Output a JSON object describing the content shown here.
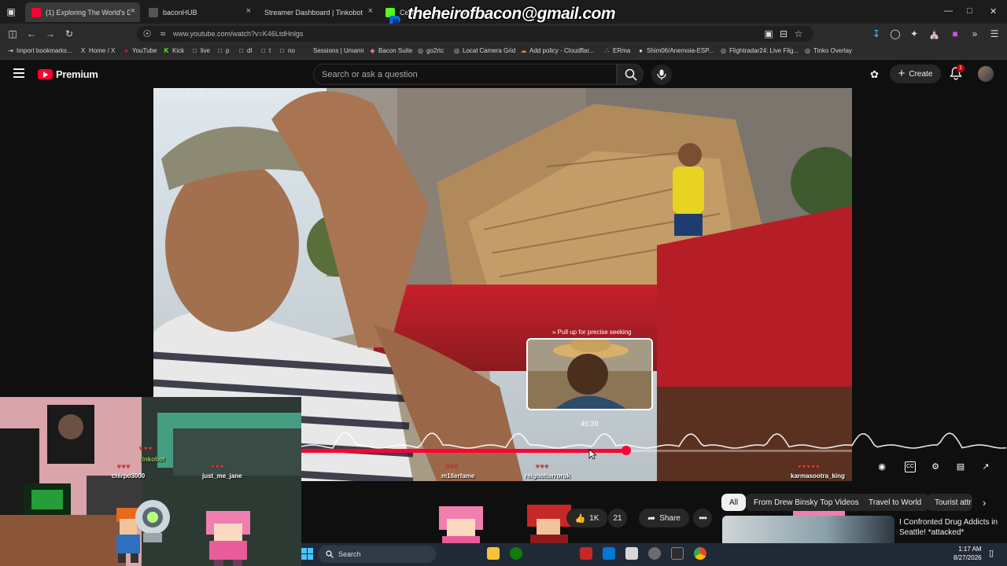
{
  "tabs": [
    {
      "label": "(1) Exploring The World's D",
      "active": true
    },
    {
      "label": "baconHUB",
      "active": false
    },
    {
      "label": "Streamer Dashboard | Tinkobot",
      "active": false
    },
    {
      "label": "Cellfmade Stream - Watch",
      "active": false
    }
  ],
  "address": {
    "url": "www.youtube.com/watch?v=K46LtdHnlgs"
  },
  "bookmarks": [
    "Import bookmarks...",
    "Home / X",
    "YouTube",
    "Kick",
    "live",
    "p",
    "dl",
    "t",
    "no",
    "Sessions | Umami",
    "Bacon Suite",
    "go2rtc",
    "Local Camera Grid",
    "Add policy - Cloudflar...",
    "ERma",
    "Shim06/Anemoia-ESP...",
    "Flightradar24: Live Flig...",
    "Tinko Overlay"
  ],
  "youtube": {
    "brand": "Premium",
    "search_placeholder": "Search or ask a question",
    "create_label": "Create",
    "notification_count": "1"
  },
  "video": {
    "overlay_title": "GARBAGE CITY (CAIRO) —",
    "seek_hint": "» Pull up for precise seeking",
    "seek_time": "46:39",
    "progress": 0.59
  },
  "stream_overlay": {
    "email": "theheirofbacon@gmail.com",
    "chatters": [
      "tinkobot",
      "chirpo3000",
      "just_me_jane",
      "m1llerfame",
      "reignofterroruk",
      "karmasootra_king"
    ]
  },
  "actions": {
    "like_count": "1K",
    "comment_count": "21",
    "share_label": "Share"
  },
  "chips": [
    "All",
    "From Drew Binsky Top Videos",
    "Travel to World",
    "Tourist attr"
  ],
  "recommended": {
    "title": "I Confronted Drug Addicts in Seattle! *attacked*"
  },
  "taskbar": {
    "search_label": "Search",
    "time": "1:17 AM",
    "date": "8/27/2026"
  },
  "colors": {
    "youtube_red": "#ff0033",
    "progress_red": "#ff0033",
    "background": "#0f0f0f"
  }
}
